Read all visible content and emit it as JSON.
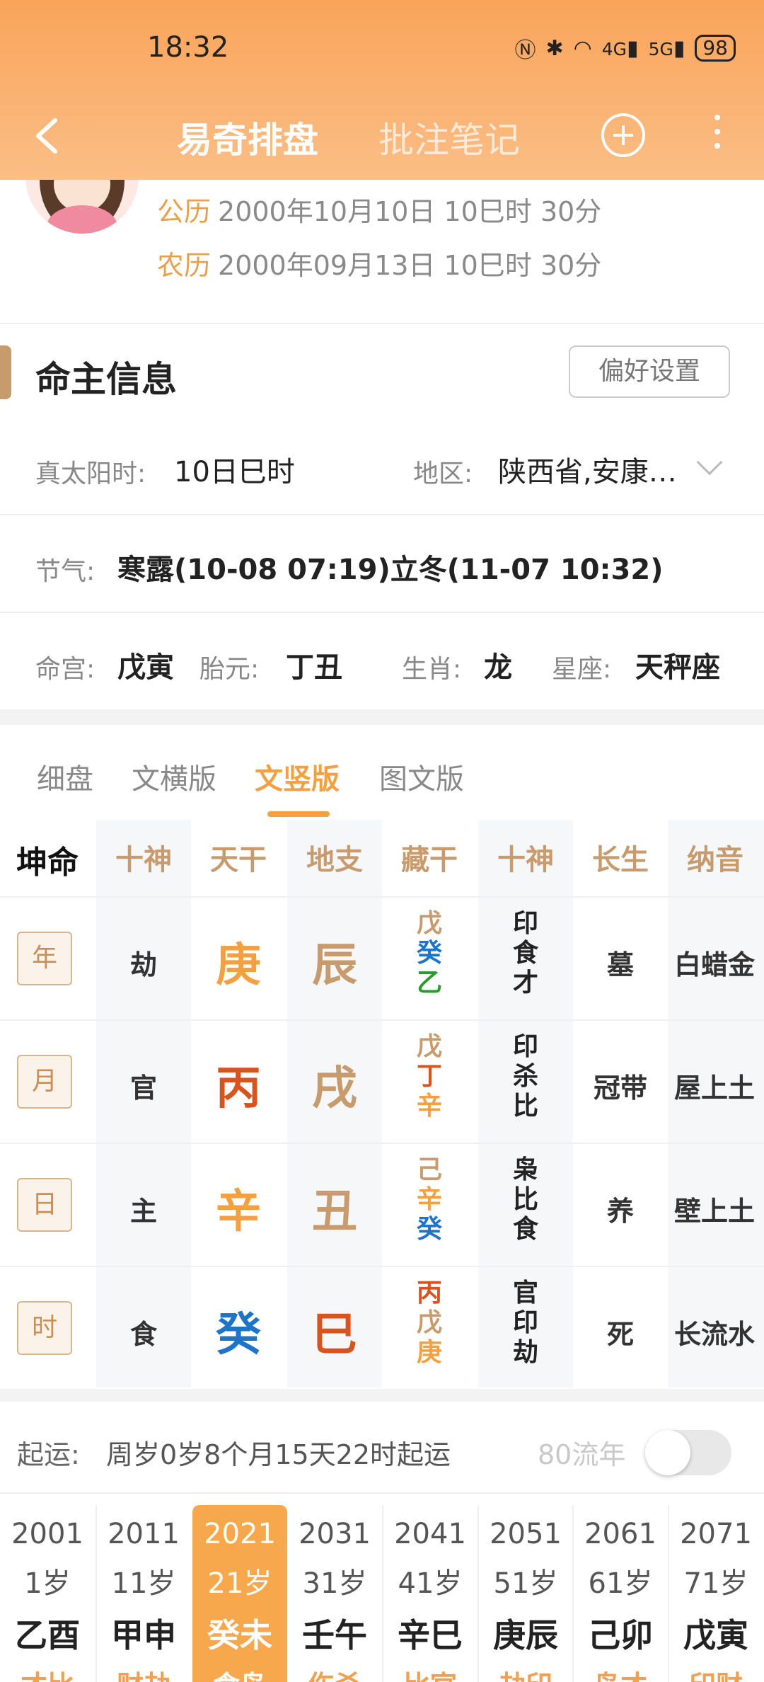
{
  "status_bar": {
    "time": "18:32",
    "battery": "98",
    "signal_1": "4G",
    "signal_2": "5G"
  },
  "nav": {
    "tab_active": "易奇排盘",
    "tab_inactive": "批注笔记"
  },
  "profile": {
    "solar_label": "公历",
    "solar_value": "2000年10月10日 10巳时 30分",
    "lunar_label": "农历",
    "lunar_value": "2000年09月13日 10巳时 30分"
  },
  "info": {
    "title": "命主信息",
    "pref_button": "偏好设置",
    "solar_time_label": "真太阳时:",
    "solar_time_value": "10日巳时",
    "region_label": "地区:",
    "region_value": "陕西省,安康…",
    "jieqi_label": "节气:",
    "jieqi_value": "寒露(10-08 07:19)立冬(11-07 10:32)",
    "minggong_label": "命宫:",
    "minggong_value": "戊寅",
    "taiyuan_label": "胎元:",
    "taiyuan_value": "丁丑",
    "zodiac_label": "生肖:",
    "zodiac_value": "龙",
    "star_label": "星座:",
    "star_value": "天秤座"
  },
  "tabs": [
    "细盘",
    "文横版",
    "文竖版",
    "图文版"
  ],
  "grid": {
    "headers": [
      "坤命",
      "十神",
      "天干",
      "地支",
      "藏干",
      "十神",
      "长生",
      "纳音"
    ],
    "rows": [
      {
        "pillar": "年",
        "shishen": "劫",
        "gan": "庚",
        "zhi": "辰",
        "canggan": [
          "戊",
          "癸",
          "乙"
        ],
        "ss_stack": [
          "印",
          "食",
          "才"
        ],
        "changsheng": "墓",
        "nayin": "白蜡金"
      },
      {
        "pillar": "月",
        "shishen": "官",
        "gan": "丙",
        "zhi": "戌",
        "canggan": [
          "戊",
          "丁",
          "辛"
        ],
        "ss_stack": [
          "印",
          "杀",
          "比"
        ],
        "changsheng": "冠带",
        "nayin": "屋上土"
      },
      {
        "pillar": "日",
        "shishen": "主",
        "gan": "辛",
        "zhi": "丑",
        "canggan": [
          "己",
          "辛",
          "癸"
        ],
        "ss_stack": [
          "枭",
          "比",
          "食"
        ],
        "changsheng": "养",
        "nayin": "壁上土"
      },
      {
        "pillar": "时",
        "shishen": "食",
        "gan": "癸",
        "zhi": "巳",
        "canggan": [
          "丙",
          "戊",
          "庚"
        ],
        "ss_stack": [
          "官",
          "印",
          "劫"
        ],
        "changsheng": "死",
        "nayin": "长流水"
      }
    ]
  },
  "qiyun": {
    "label": "起运:",
    "value": "周岁0岁8个月15天22时起运",
    "liunian_label": "80流年"
  },
  "dayun": [
    {
      "year": "2001",
      "age": "1岁",
      "ganzhi": "乙酉",
      "shishen": "才比"
    },
    {
      "year": "2011",
      "age": "11岁",
      "ganzhi": "甲申",
      "shishen": "财劫"
    },
    {
      "year": "2021",
      "age": "21岁",
      "ganzhi": "癸未",
      "shishen": "食枭"
    },
    {
      "year": "2031",
      "age": "31岁",
      "ganzhi": "壬午",
      "shishen": "伤杀"
    },
    {
      "year": "2041",
      "age": "41岁",
      "ganzhi": "辛巳",
      "shishen": "比官"
    },
    {
      "year": "2051",
      "age": "51岁",
      "ganzhi": "庚辰",
      "shishen": "劫印"
    },
    {
      "year": "2061",
      "age": "61岁",
      "ganzhi": "己卯",
      "shishen": "枭才"
    },
    {
      "year": "2071",
      "age": "71岁",
      "ganzhi": "戊寅",
      "shishen": "印财"
    }
  ],
  "colors": {
    "accent": "#f5a040",
    "metal": "#f5a040",
    "fire": "#d9531e",
    "earth": "#c89b6e",
    "water": "#1e74c8",
    "wood": "#2e9a2e",
    "fire_light": "#e07a5a"
  }
}
